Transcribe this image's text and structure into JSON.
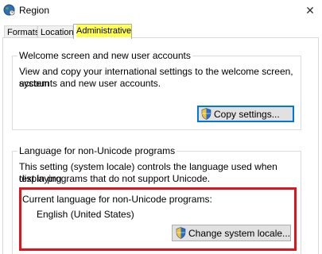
{
  "window": {
    "title": "Region",
    "close_glyph": "✕"
  },
  "tabs": [
    {
      "label": "Formats",
      "active": false
    },
    {
      "label": "Location",
      "active": false
    },
    {
      "label": "Administrative",
      "active": true
    }
  ],
  "welcome_group": {
    "title": "Welcome screen and new user accounts",
    "description_line1": "View and copy your international settings to the welcome screen, system",
    "description_line2": "accounts and new user accounts.",
    "copy_button_label": "Copy settings..."
  },
  "unicode_group": {
    "title": "Language for non-Unicode programs",
    "description_line1": "This setting (system locale) controls the language used when displaying",
    "description_line2": "text in programs that do not support Unicode.",
    "current_label": "Current language for non-Unicode programs:",
    "current_value": "English (United States)",
    "change_button_label": "Change system locale..."
  },
  "icons": {
    "window_icon": "globe-clock-icon",
    "button_icon": "uac-shield-icon"
  },
  "colors": {
    "highlight": "#ffff55",
    "annotation_box": "#e0141e",
    "focus_border": "#0078d7"
  }
}
